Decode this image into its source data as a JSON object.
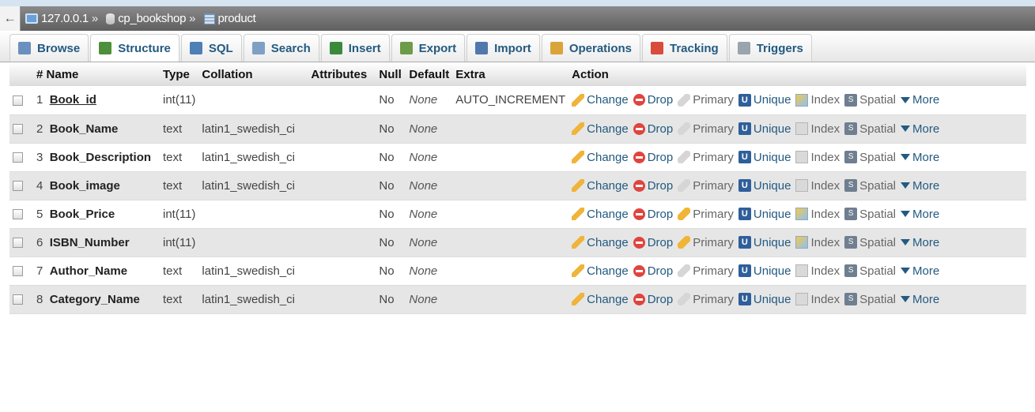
{
  "breadcrumb": {
    "server": "127.0.0.1",
    "database": "cp_bookshop",
    "table": "product",
    "separator": "»"
  },
  "tabs": [
    {
      "label": "Browse",
      "icon": "browse-icon",
      "color": "#6b8fbf"
    },
    {
      "label": "Structure",
      "icon": "structure-icon",
      "color": "#4d8f3a"
    },
    {
      "label": "SQL",
      "icon": "sql-icon",
      "color": "#4e7fb5"
    },
    {
      "label": "Search",
      "icon": "search-icon",
      "color": "#7f9fc4"
    },
    {
      "label": "Insert",
      "icon": "insert-icon",
      "color": "#3b8a3b"
    },
    {
      "label": "Export",
      "icon": "export-icon",
      "color": "#6e9b4a"
    },
    {
      "label": "Import",
      "icon": "import-icon",
      "color": "#4f78ad"
    },
    {
      "label": "Operations",
      "icon": "wrench-icon",
      "color": "#d9a43a"
    },
    {
      "label": "Tracking",
      "icon": "eye-icon",
      "color": "#d94b3b"
    },
    {
      "label": "Triggers",
      "icon": "triggers-icon",
      "color": "#9aa4ad"
    }
  ],
  "columns": {
    "num": "#",
    "name": "Name",
    "type": "Type",
    "collation": "Collation",
    "attributes": "Attributes",
    "null": "Null",
    "default": "Default",
    "extra": "Extra",
    "action": "Action"
  },
  "actions": {
    "change": "Change",
    "drop": "Drop",
    "primary": "Primary",
    "unique": "Unique",
    "index": "Index",
    "spatial": "Spatial",
    "more": "More"
  },
  "rows": [
    {
      "num": "1",
      "name": "Book_id",
      "type": "int(11)",
      "collation": "",
      "attributes": "",
      "null": "No",
      "default": "None",
      "extra": "AUTO_INCREMENT",
      "primary_active": false,
      "index_active": true,
      "is_primary_key": true
    },
    {
      "num": "2",
      "name": "Book_Name",
      "type": "text",
      "collation": "latin1_swedish_ci",
      "attributes": "",
      "null": "No",
      "default": "None",
      "extra": "",
      "primary_active": false,
      "index_active": false,
      "is_primary_key": false
    },
    {
      "num": "3",
      "name": "Book_Description",
      "type": "text",
      "collation": "latin1_swedish_ci",
      "attributes": "",
      "null": "No",
      "default": "None",
      "extra": "",
      "primary_active": false,
      "index_active": false,
      "is_primary_key": false
    },
    {
      "num": "4",
      "name": "Book_image",
      "type": "text",
      "collation": "latin1_swedish_ci",
      "attributes": "",
      "null": "No",
      "default": "None",
      "extra": "",
      "primary_active": false,
      "index_active": false,
      "is_primary_key": false
    },
    {
      "num": "5",
      "name": "Book_Price",
      "type": "int(11)",
      "collation": "",
      "attributes": "",
      "null": "No",
      "default": "None",
      "extra": "",
      "primary_active": true,
      "index_active": true,
      "is_primary_key": false
    },
    {
      "num": "6",
      "name": "ISBN_Number",
      "type": "int(11)",
      "collation": "",
      "attributes": "",
      "null": "No",
      "default": "None",
      "extra": "",
      "primary_active": true,
      "index_active": true,
      "is_primary_key": false
    },
    {
      "num": "7",
      "name": "Author_Name",
      "type": "text",
      "collation": "latin1_swedish_ci",
      "attributes": "",
      "null": "No",
      "default": "None",
      "extra": "",
      "primary_active": false,
      "index_active": false,
      "is_primary_key": false
    },
    {
      "num": "8",
      "name": "Category_Name",
      "type": "text",
      "collation": "latin1_swedish_ci",
      "attributes": "",
      "null": "No",
      "default": "None",
      "extra": "",
      "primary_active": false,
      "index_active": false,
      "is_primary_key": false
    }
  ]
}
